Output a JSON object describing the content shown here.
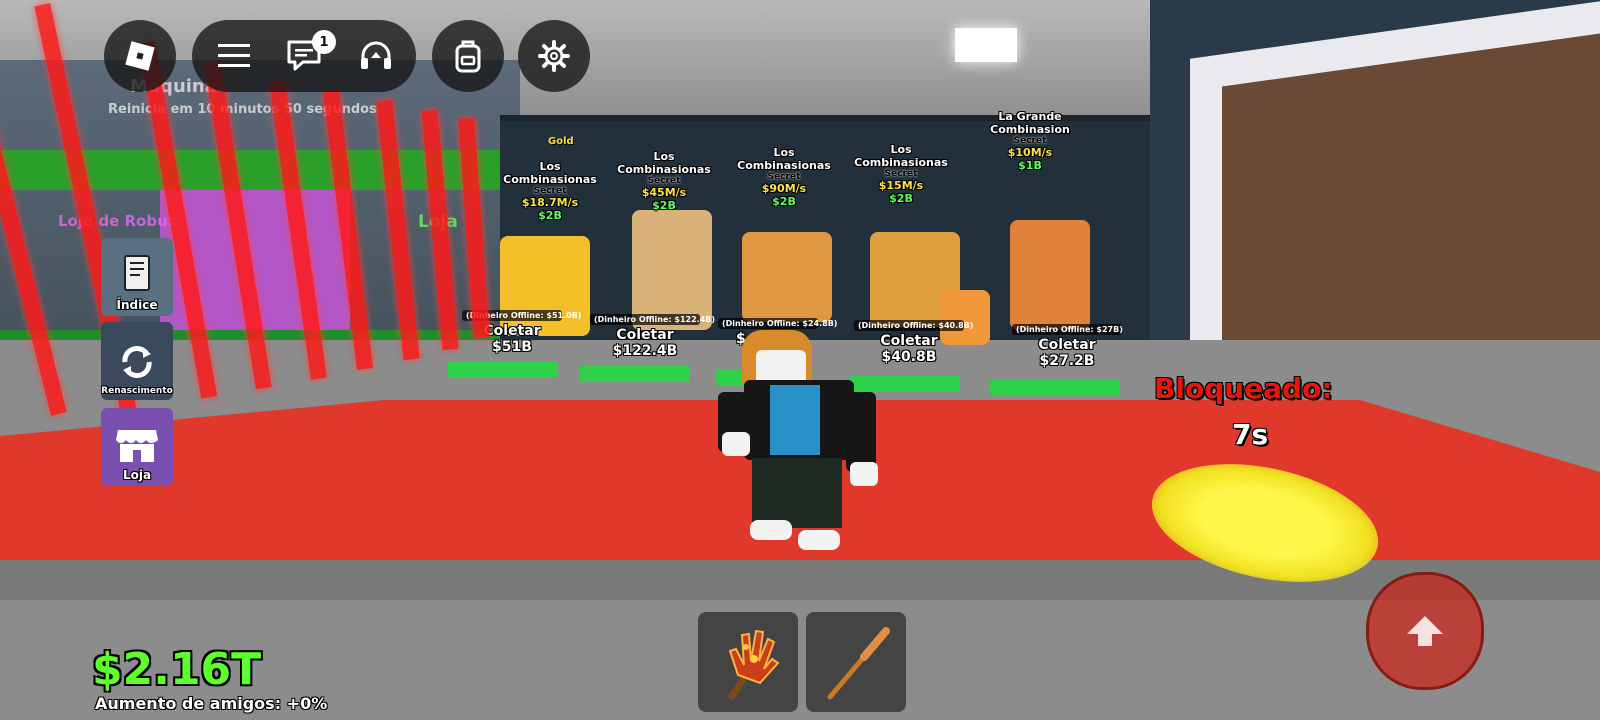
{
  "topbar": {
    "chat_badge_count": "1",
    "icons": [
      "roblox-logo-icon",
      "menu-icon",
      "chat-icon",
      "headset-icon",
      "backpack-icon",
      "gear-icon"
    ]
  },
  "background_text": {
    "faded_title": "Maquina",
    "faded_timer": "Reinicia em 10 minutos 50 segundos",
    "shop_robux": "Loja de Robux",
    "shop_loja": "Loja"
  },
  "side_buttons": {
    "index": "Índice",
    "rebirth": "Renascimento",
    "shop": "Loja"
  },
  "slots": [
    {
      "name": "Los Combinasionas",
      "rarity": "Secret",
      "rate": "$18.7M/s",
      "price": "$2B",
      "gold": "Gold"
    },
    {
      "name": "Los Combinasionas",
      "rarity": "Secret",
      "rate": "$45M/s",
      "price": "$2B"
    },
    {
      "name": "Los Combinasionas",
      "rarity": "Secret",
      "rate": "$90M/s",
      "price": "$2B"
    },
    {
      "name": "Los Combinasionas",
      "rarity": "Secret",
      "rate": "$15M/s",
      "price": "$2B"
    },
    {
      "name": "La Grande Combinasion",
      "rarity": "Secret",
      "rate": "$10M/s",
      "price": "$1B"
    }
  ],
  "collectors": [
    {
      "offline": "(Dinheiro Offline: $51.0B)",
      "label": "Coletar",
      "amount": "$51B"
    },
    {
      "offline": "(Dinheiro Offline: $122.4B)",
      "label": "Coletar",
      "amount": "$122.4B"
    },
    {
      "offline": "(Dinheiro Offline: $24.8B)",
      "label": "",
      "amount": "$"
    },
    {
      "offline": "(Dinheiro Offline: $40.8B)",
      "label": "Coletar",
      "amount": "$40.8B"
    },
    {
      "offline": "(Dinheiro Offline: $27B)",
      "label": "Coletar",
      "amount": "$27.2B"
    }
  ],
  "base_status": {
    "label": "Bloqueado:",
    "timer": "7s"
  },
  "player": {
    "money": "$2.16T",
    "friends_boost": "Aumento de amigos: +0%"
  },
  "hotbar": [
    {
      "item": "lava-glove-icon"
    },
    {
      "item": "bat-icon"
    }
  ],
  "colors": {
    "money": "#5cff2c",
    "blocked": "#e8140e",
    "carpet": "#e0382a",
    "laser": "#ff1a1a"
  }
}
